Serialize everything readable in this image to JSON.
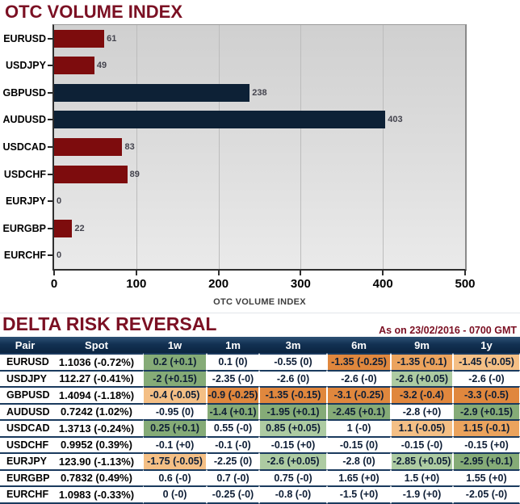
{
  "chart_data": [
    {
      "type": "bar",
      "orientation": "horizontal",
      "title": "OTC VOLUME INDEX",
      "title_color": "#7b1023",
      "xlabel": "OTC VOLUME INDEX",
      "categories": [
        "EURUSD",
        "USDJPY",
        "GBPUSD",
        "AUDUSD",
        "USDCAD",
        "USDCHF",
        "EURJPY",
        "EURGBP",
        "EURCHF"
      ],
      "values": [
        61,
        49,
        238,
        403,
        83,
        89,
        0,
        22,
        0
      ],
      "bar_color_keys": [
        "maroon",
        "maroon",
        "navy",
        "navy",
        "maroon",
        "maroon",
        "maroon",
        "maroon",
        "maroon"
      ],
      "colors": {
        "maroon": "#7d0c0d",
        "navy": "#0d2136"
      },
      "xlim": [
        0,
        500
      ],
      "x_ticks": [
        0,
        100,
        200,
        300,
        400,
        500
      ],
      "grid": true,
      "value_labels": true
    },
    {
      "type": "table",
      "title": "DELTA RISK REVERSAL",
      "title_color": "#7b1023",
      "as_on": "As on 23/02/2016 - 0700 GMT",
      "columns": [
        "Pair",
        "Spot",
        "1w",
        "1m",
        "3m",
        "6m",
        "9m",
        "1y"
      ],
      "cell_colors": {
        "green_strong": "#85ab77",
        "green_light": "#adcba2",
        "orange_strong": "#e0873d",
        "orange_medium": "#eba35d",
        "orange_light": "#f4bf85",
        "none": "#ffffff"
      },
      "rows": [
        {
          "pair": "EURUSD",
          "spot": "1.1036 (-0.72%)",
          "cells": [
            {
              "v": "0.2 (+0.1)",
              "c": "green_strong"
            },
            {
              "v": "0.1 (0)",
              "c": "none"
            },
            {
              "v": "-0.55 (0)",
              "c": "none"
            },
            {
              "v": "-1.35 (-0.25)",
              "c": "orange_strong"
            },
            {
              "v": "-1.35 (-0.1)",
              "c": "orange_medium"
            },
            {
              "v": "-1.45 (-0.05)",
              "c": "orange_light"
            }
          ]
        },
        {
          "pair": "USDJPY",
          "spot": "112.27 (-0.41%)",
          "cells": [
            {
              "v": "-2 (+0.15)",
              "c": "green_strong"
            },
            {
              "v": "-2.35 (-0)",
              "c": "none"
            },
            {
              "v": "-2.6 (0)",
              "c": "none"
            },
            {
              "v": "-2.6 (-0)",
              "c": "none"
            },
            {
              "v": "-2.6 (+0.05)",
              "c": "green_light"
            },
            {
              "v": "-2.6 (-0)",
              "c": "none"
            }
          ]
        },
        {
          "pair": "GBPUSD",
          "spot": "1.4094 (-1.18%)",
          "cells": [
            {
              "v": "-0.4 (-0.05)",
              "c": "orange_light"
            },
            {
              "v": "-0.9 (-0.25)",
              "c": "orange_strong"
            },
            {
              "v": "-1.35 (-0.15)",
              "c": "orange_strong"
            },
            {
              "v": "-3.1 (-0.25)",
              "c": "orange_strong"
            },
            {
              "v": "-3.2 (-0.4)",
              "c": "orange_strong"
            },
            {
              "v": "-3.3 (-0.5)",
              "c": "orange_strong"
            }
          ]
        },
        {
          "pair": "AUDUSD",
          "spot": "0.7242 (1.02%)",
          "cells": [
            {
              "v": "-0.95 (0)",
              "c": "none"
            },
            {
              "v": "-1.4 (+0.1)",
              "c": "green_strong"
            },
            {
              "v": "-1.95 (+0.1)",
              "c": "green_strong"
            },
            {
              "v": "-2.45 (+0.1)",
              "c": "green_strong"
            },
            {
              "v": "-2.8 (+0)",
              "c": "none"
            },
            {
              "v": "-2.9 (+0.15)",
              "c": "green_strong"
            }
          ]
        },
        {
          "pair": "USDCAD",
          "spot": "1.3713 (-0.24%)",
          "cells": [
            {
              "v": "0.25 (+0.1)",
              "c": "green_strong"
            },
            {
              "v": "0.55 (-0)",
              "c": "none"
            },
            {
              "v": "0.85 (+0.05)",
              "c": "green_light"
            },
            {
              "v": "1 (-0)",
              "c": "none"
            },
            {
              "v": "1.1 (-0.05)",
              "c": "orange_light"
            },
            {
              "v": "1.15 (-0.1)",
              "c": "orange_medium"
            }
          ]
        },
        {
          "pair": "USDCHF",
          "spot": "0.9952 (0.39%)",
          "cells": [
            {
              "v": "-0.1 (+0)",
              "c": "none"
            },
            {
              "v": "-0.1 (-0)",
              "c": "none"
            },
            {
              "v": "-0.15 (+0)",
              "c": "none"
            },
            {
              "v": "-0.15 (0)",
              "c": "none"
            },
            {
              "v": "-0.15 (-0)",
              "c": "none"
            },
            {
              "v": "-0.15 (+0)",
              "c": "none"
            }
          ]
        },
        {
          "pair": "EURJPY",
          "spot": "123.90 (-1.13%)",
          "cells": [
            {
              "v": "-1.75 (-0.05)",
              "c": "orange_light"
            },
            {
              "v": "-2.25 (0)",
              "c": "none"
            },
            {
              "v": "-2.6 (+0.05)",
              "c": "green_light"
            },
            {
              "v": "-2.8 (0)",
              "c": "none"
            },
            {
              "v": "-2.85 (+0.05)",
              "c": "green_light"
            },
            {
              "v": "-2.95 (+0.1)",
              "c": "green_strong"
            }
          ]
        },
        {
          "pair": "EURGBP",
          "spot": "0.7832 (0.49%)",
          "cells": [
            {
              "v": "0.6 (-0)",
              "c": "none"
            },
            {
              "v": "0.7 (-0)",
              "c": "none"
            },
            {
              "v": "0.75 (-0)",
              "c": "none"
            },
            {
              "v": "1.65 (+0)",
              "c": "none"
            },
            {
              "v": "1.5 (+0)",
              "c": "none"
            },
            {
              "v": "1.55 (+0)",
              "c": "none"
            }
          ]
        },
        {
          "pair": "EURCHF",
          "spot": "1.0983 (-0.33%)",
          "cells": [
            {
              "v": "0 (-0)",
              "c": "none"
            },
            {
              "v": "-0.25 (-0)",
              "c": "none"
            },
            {
              "v": "-0.8 (-0)",
              "c": "none"
            },
            {
              "v": "-1.5 (+0)",
              "c": "none"
            },
            {
              "v": "-1.9 (+0)",
              "c": "none"
            },
            {
              "v": "-2.05 (-0)",
              "c": "none"
            }
          ]
        }
      ]
    }
  ]
}
